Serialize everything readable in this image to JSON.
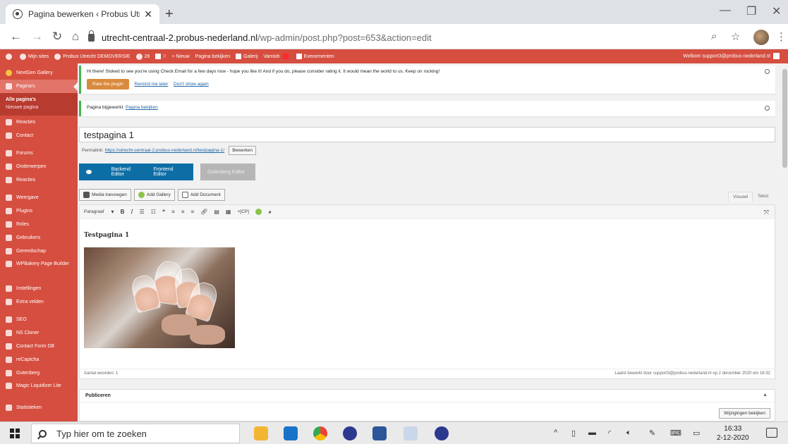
{
  "browser": {
    "tab_title": "Pagina bewerken ‹ Probus Utrecht",
    "url_host": "utrecht-centraal-2.probus-nederland.nl",
    "url_path": "/wp-admin/post.php?post=653&action=edit"
  },
  "adminbar": {
    "items": [
      "Mijn sites",
      "Probus Utrecht DEMOVERSIE",
      "28",
      "0",
      "+ Nieuw",
      "Pagina bekijken",
      "Galerij",
      "Varnish",
      "Evenementen"
    ],
    "welcome": "Welkom support3@probus-nederland.nl"
  },
  "sidebar": {
    "top_item": "NextGen Gallery",
    "active": "Pagina's",
    "sub": [
      "Alle pagina's",
      "Nieuwe pagina"
    ],
    "items": [
      "Reacties",
      "Contact",
      "Forums",
      "Onderwerpen",
      "Reacties",
      "Weergave",
      "Plugins",
      "Roles",
      "Gebruikers",
      "Gereedschap"
    ],
    "wpbakery": "WPBakery Page Builder",
    "items2": [
      "Instellingen",
      "Extra velden",
      "SEO",
      "NS Cloner",
      "Contact Form DB",
      "reCaptcha",
      "Gutenberg"
    ],
    "magic": "Magic Liquidizer Lite",
    "last": "Statistieken"
  },
  "notice1": {
    "text": "Hi there! Stoked to see you're using Check Email for a few days now - hope you like it! And if you do, please consider rating it. It would mean the world to us. Keep on rocking!",
    "rate": "Rate the plugin",
    "remind": "Remind me later",
    "dont": "Don't show again"
  },
  "notice2": {
    "text": "Pagina bijgewerkt.",
    "link": "Pagina bekijken"
  },
  "post": {
    "title": "testpagina 1",
    "permalink_label": "Permalink:",
    "permalink_url": "https://utrecht-centraal-2.probus-nederland.nl/testpagina-1/",
    "edit_button": "Bewerken"
  },
  "editor_switch": {
    "backend": "Backend Editor",
    "frontend": "Frontend Editor",
    "gutenberg": "Gutenberg Editor"
  },
  "media": {
    "add_media": "Media toevoegen",
    "add_gallery": "Add Gallery",
    "add_document": "Add Document",
    "tab_visual": "Visueel",
    "tab_text": "Tekst"
  },
  "toolbar": {
    "format": "Paragraaf",
    "cp": "+[CP]"
  },
  "editor": {
    "heading": "Testpagina 1",
    "word_count": "Aantal woorden: 1",
    "last_edit": "Laatst bewerkt door support3@probus-nederland.nl op 2 december 2020 om 16:32"
  },
  "publish": {
    "title": "Publiceren",
    "preview": "Wijzigingen bekijken"
  },
  "taskbar": {
    "search": "Typ hier om te zoeken",
    "time": "16:33",
    "date": "2-12-2020"
  }
}
